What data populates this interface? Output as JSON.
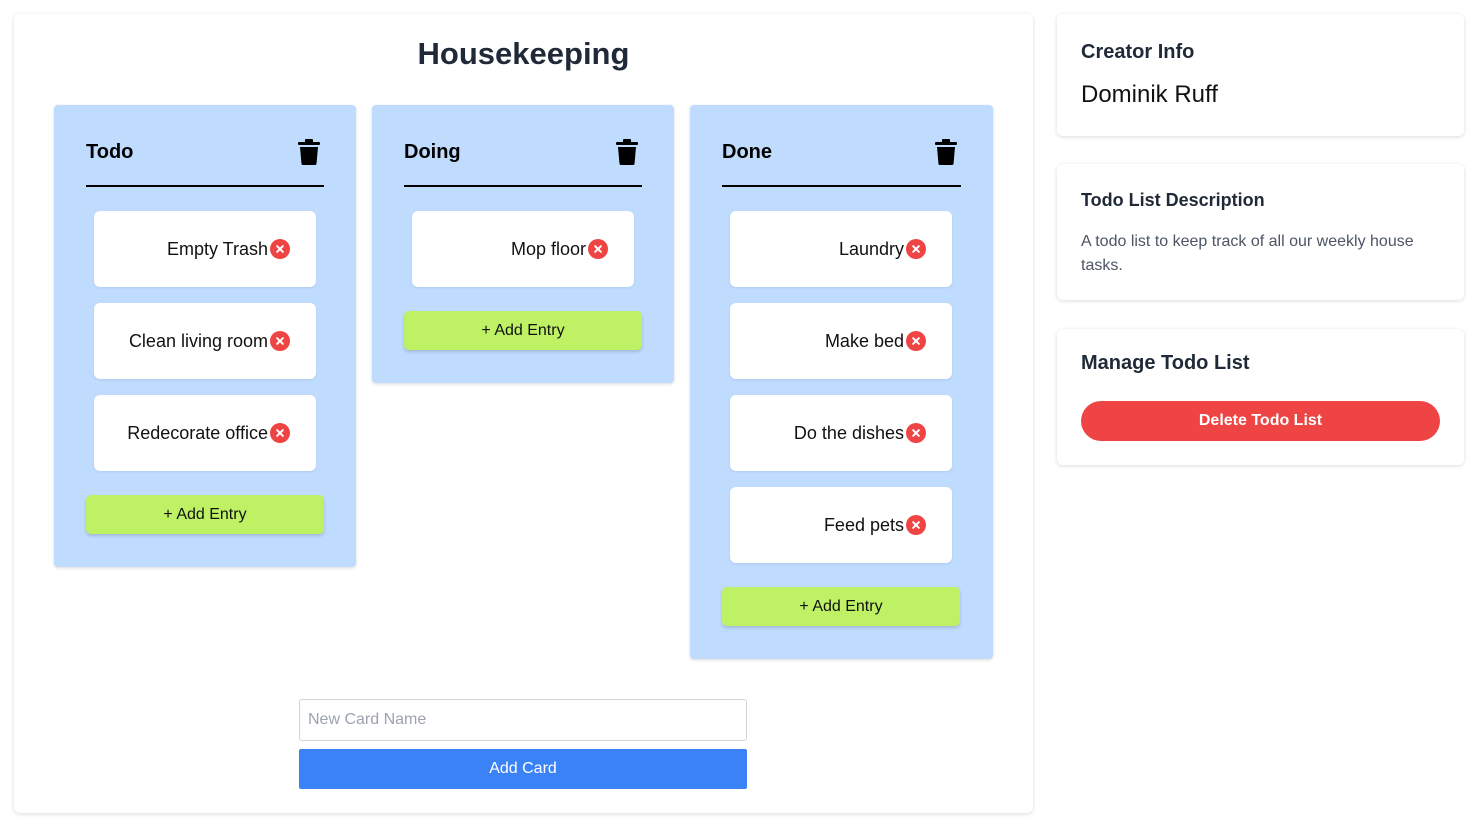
{
  "board": {
    "title": "Housekeeping",
    "columns": [
      {
        "title": "Todo",
        "entries": [
          "Empty Trash",
          "Clean living room",
          "Redecorate office"
        ],
        "add_label": "+ Add Entry"
      },
      {
        "title": "Doing",
        "entries": [
          "Mop floor"
        ],
        "add_label": "+ Add Entry"
      },
      {
        "title": "Done",
        "entries": [
          "Laundry",
          "Make bed",
          "Do the dishes",
          "Feed pets"
        ],
        "add_label": "+ Add Entry"
      }
    ],
    "new_card_placeholder": "New Card Name",
    "add_card_label": "Add Card"
  },
  "sidebar": {
    "creator": {
      "heading": "Creator Info",
      "name": "Dominik Ruff"
    },
    "description": {
      "heading": "Todo List Description",
      "text": "A todo list to keep track of all our weekly house tasks."
    },
    "manage": {
      "heading": "Manage Todo List",
      "delete_label": "Delete Todo List"
    }
  },
  "colors": {
    "column_bg": "#bfdbfe",
    "add_entry_bg": "#bef264",
    "add_card_bg": "#3b82f6",
    "danger": "#ef4444"
  },
  "icons": {
    "column_delete": "trash-icon",
    "entry_remove": "remove-circle-icon"
  }
}
